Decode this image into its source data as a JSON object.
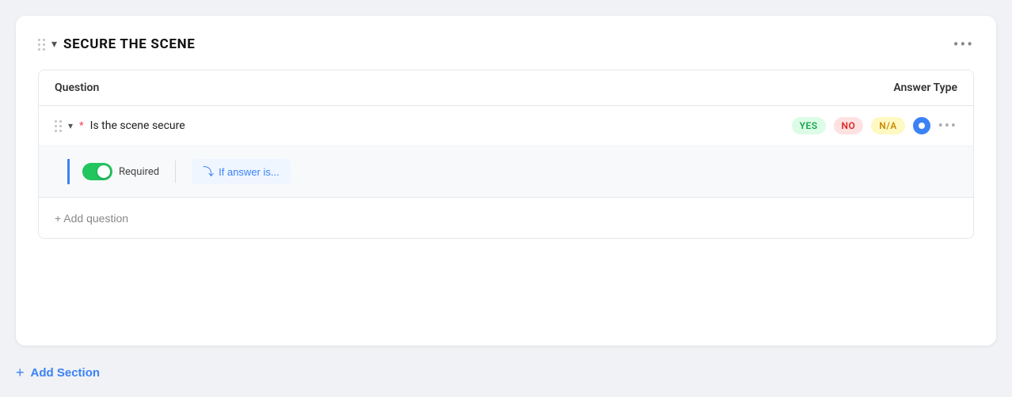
{
  "section": {
    "title": "SECURE THE SCENE",
    "more_icon": "•••"
  },
  "table": {
    "header_question": "Question",
    "header_answer_type": "Answer Type"
  },
  "question_row": {
    "question_text": "Is the scene secure",
    "required_indicator": "*",
    "badges": {
      "yes": "YES",
      "no": "NO",
      "na": "N/A"
    }
  },
  "sub_row": {
    "toggle_label": "Required",
    "if_answer_label": "If answer is..."
  },
  "add_question": {
    "label": "+ Add question"
  },
  "add_section": {
    "label": "Add Section",
    "plus": "+"
  }
}
